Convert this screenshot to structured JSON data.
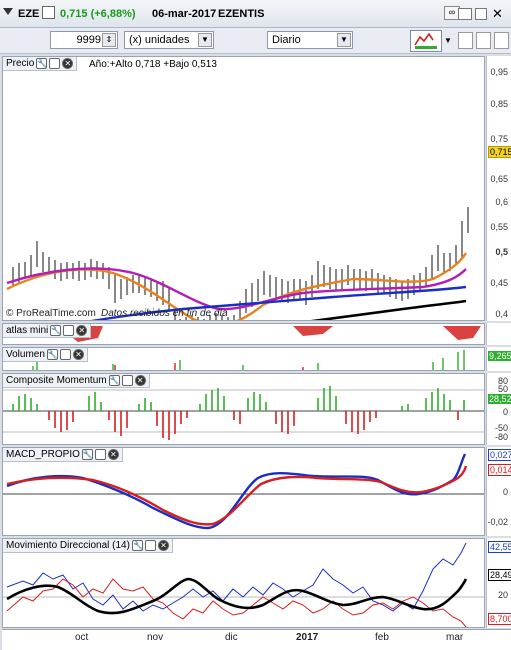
{
  "header": {
    "symbol": "EZE",
    "last": "0,715 (+6,88%)",
    "date": "06-mar-2017",
    "name": "EZENTIS"
  },
  "toolbar": {
    "units_value": "9999",
    "units_label": "(x) unidades",
    "period": "Diario"
  },
  "price_panel": {
    "title": "Precio",
    "info": "Año:+Alto 0,718 +Bajo 0,513",
    "watermark": "© ProRealTime.com",
    "watermark_note": "Datos recibidos en fin de día",
    "ticks": [
      "0,95",
      "0,85",
      "0,75",
      "0,65",
      "0,6",
      "0,55",
      "0,5",
      "0,45",
      "0,4"
    ],
    "last_tag": "0,715"
  },
  "atlas_panel": {
    "title": "atlas mini"
  },
  "volume_panel": {
    "title": "Volumen",
    "last_tag": "9,265"
  },
  "momentum_panel": {
    "title": "Composite Momentum",
    "ticks": [
      "80",
      "50",
      "0",
      "-50",
      "-80"
    ],
    "last_tag": "28,52"
  },
  "macd_panel": {
    "title": "MACD_PROPIO",
    "ticks": [
      "0,027",
      "0,014",
      "0",
      "-0,02"
    ]
  },
  "dmi_panel": {
    "title": "Movimiento Direccional (14)",
    "ticks": [
      "42,55",
      "28,49",
      "20",
      "8,700"
    ]
  },
  "x_axis": [
    "oct",
    "nov",
    "dic",
    "2017",
    "feb",
    "mar"
  ],
  "colors": {
    "price": "#111111",
    "ma_orange": "#e8821e",
    "ma_purple": "#b21fb5",
    "ma_blue": "#1a2fc2",
    "ma_black": "#000000",
    "positive": "#2eae2e",
    "negative": "#d42020",
    "last_price_tag": "#f2d21e",
    "blue_tag": "#1a3fd0",
    "red_tag": "#e01b1b"
  }
}
